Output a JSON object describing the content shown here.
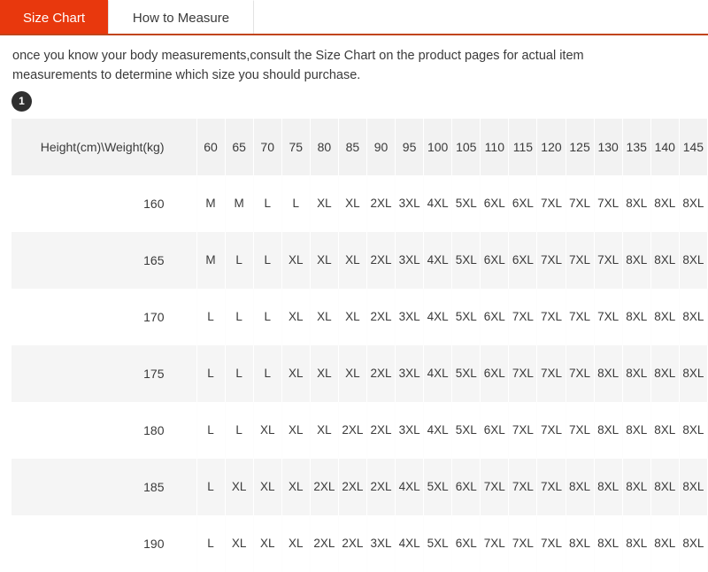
{
  "tabs": [
    {
      "label": "Size Chart",
      "active": true
    },
    {
      "label": "How to Measure",
      "active": false
    }
  ],
  "description": "once you know your body measurements,consult the Size Chart on the product pages for actual item measurements to determine which size you should purchase.",
  "step_badge": "1",
  "colors": {
    "active_tab_bg": "#e8380d",
    "tab_underline": "#c1441a",
    "header_bg": "#f2f2f2",
    "row_alt_bg": "#f5f5f5",
    "badge_bg": "#2f2f2f",
    "text": "#3a3a3a"
  },
  "chart_data": {
    "type": "table",
    "title": "Size Chart",
    "corner_header": "Height(cm)\\Weight(kg)",
    "xlabel": "Weight(kg)",
    "ylabel": "Height(cm)",
    "categories": [
      "60",
      "65",
      "70",
      "75",
      "80",
      "85",
      "90",
      "95",
      "100",
      "105",
      "110",
      "115",
      "120",
      "125",
      "130",
      "135",
      "140",
      "145"
    ],
    "rows": [
      {
        "height": "160",
        "sizes": [
          "M",
          "M",
          "L",
          "L",
          "XL",
          "XL",
          "2XL",
          "3XL",
          "4XL",
          "5XL",
          "6XL",
          "6XL",
          "7XL",
          "7XL",
          "7XL",
          "8XL",
          "8XL",
          "8XL"
        ]
      },
      {
        "height": "165",
        "sizes": [
          "M",
          "L",
          "L",
          "XL",
          "XL",
          "XL",
          "2XL",
          "3XL",
          "4XL",
          "5XL",
          "6XL",
          "6XL",
          "7XL",
          "7XL",
          "7XL",
          "8XL",
          "8XL",
          "8XL"
        ]
      },
      {
        "height": "170",
        "sizes": [
          "L",
          "L",
          "L",
          "XL",
          "XL",
          "XL",
          "2XL",
          "3XL",
          "4XL",
          "5XL",
          "6XL",
          "7XL",
          "7XL",
          "7XL",
          "7XL",
          "8XL",
          "8XL",
          "8XL"
        ]
      },
      {
        "height": "175",
        "sizes": [
          "L",
          "L",
          "L",
          "XL",
          "XL",
          "XL",
          "2XL",
          "3XL",
          "4XL",
          "5XL",
          "6XL",
          "7XL",
          "7XL",
          "7XL",
          "8XL",
          "8XL",
          "8XL",
          "8XL"
        ]
      },
      {
        "height": "180",
        "sizes": [
          "L",
          "L",
          "XL",
          "XL",
          "XL",
          "2XL",
          "2XL",
          "3XL",
          "4XL",
          "5XL",
          "6XL",
          "7XL",
          "7XL",
          "7XL",
          "8XL",
          "8XL",
          "8XL",
          "8XL"
        ]
      },
      {
        "height": "185",
        "sizes": [
          "L",
          "XL",
          "XL",
          "XL",
          "2XL",
          "2XL",
          "2XL",
          "4XL",
          "5XL",
          "6XL",
          "7XL",
          "7XL",
          "7XL",
          "8XL",
          "8XL",
          "8XL",
          "8XL",
          "8XL"
        ]
      },
      {
        "height": "190",
        "sizes": [
          "L",
          "XL",
          "XL",
          "XL",
          "2XL",
          "2XL",
          "3XL",
          "4XL",
          "5XL",
          "6XL",
          "7XL",
          "7XL",
          "7XL",
          "8XL",
          "8XL",
          "8XL",
          "8XL",
          "8XL"
        ]
      }
    ]
  }
}
